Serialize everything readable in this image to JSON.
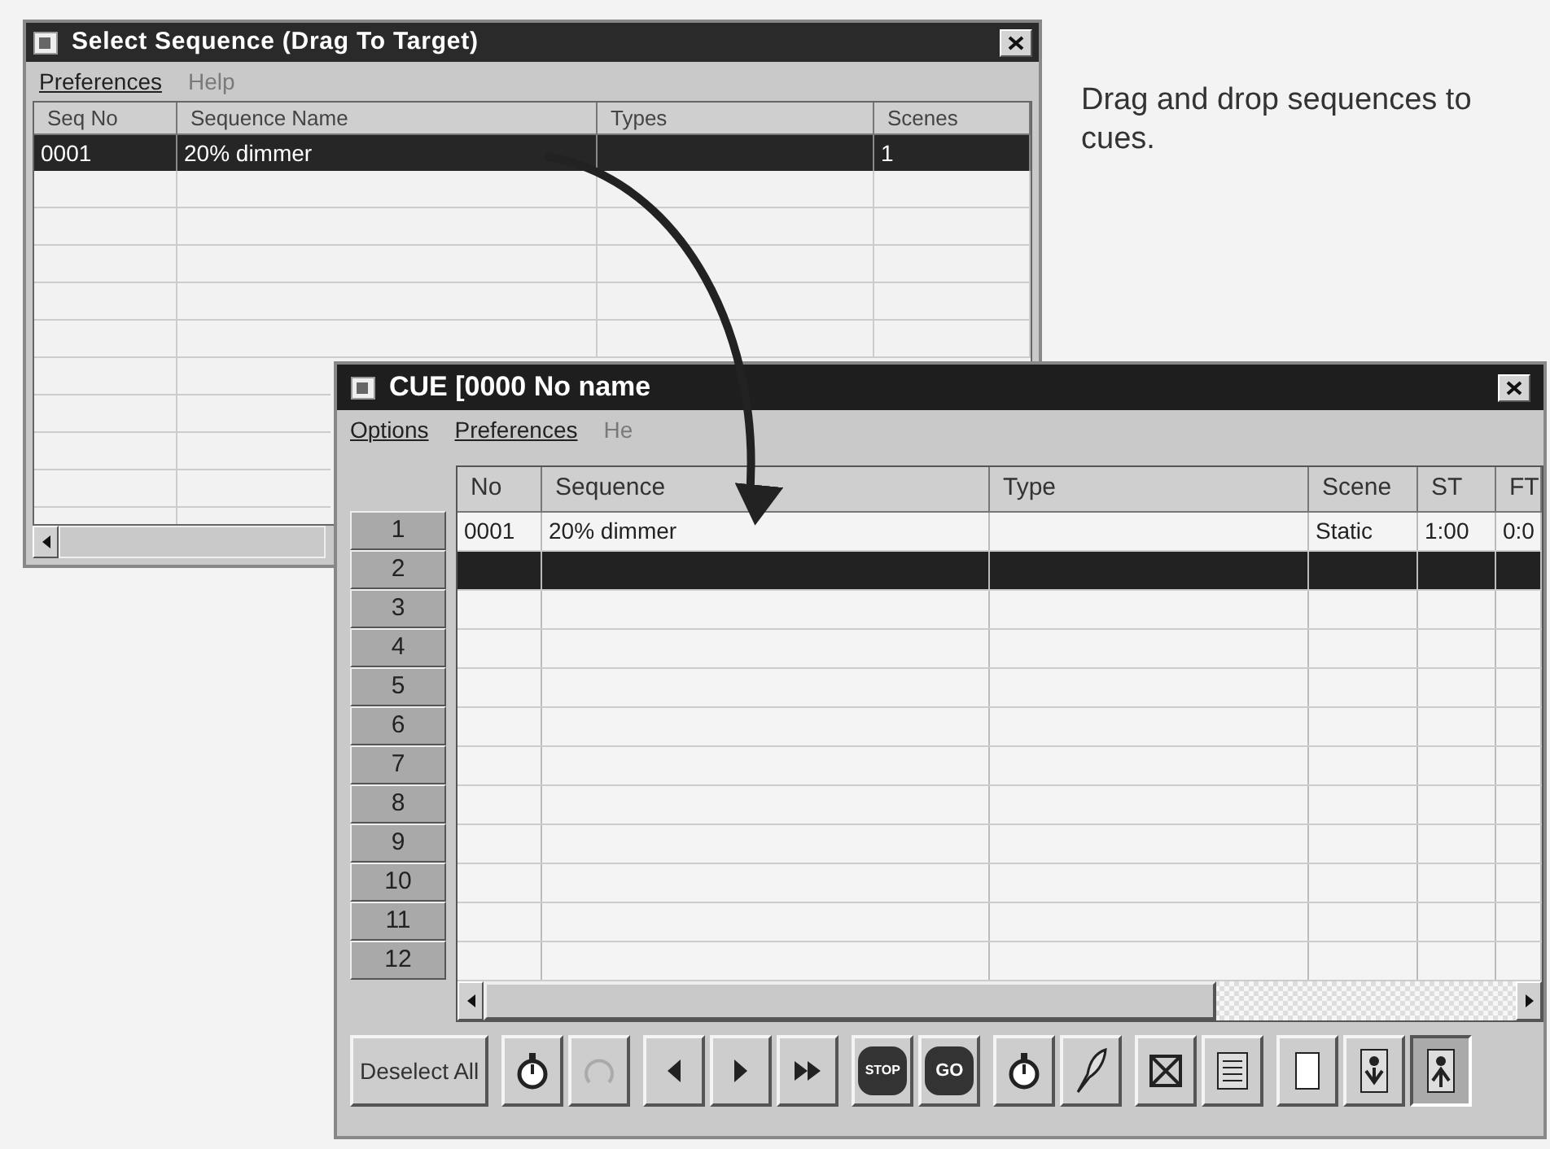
{
  "caption": "Drag and drop sequences to cues.",
  "sequence_window": {
    "title": "Select Sequence (Drag To Target)",
    "menu": [
      {
        "label": "Preferences",
        "disabled": false
      },
      {
        "label": "Help",
        "disabled": true
      }
    ],
    "columns": [
      "Seq No",
      "Sequence Name",
      "Types",
      "Scenes"
    ],
    "rows": [
      {
        "cells": [
          "0001",
          "20% dimmer",
          "",
          "1"
        ],
        "selected": true
      }
    ]
  },
  "cue_window": {
    "title": "CUE [0000 No name",
    "menu": [
      {
        "label": "Options",
        "disabled": false
      },
      {
        "label": "Preferences",
        "disabled": false
      },
      {
        "label": "He",
        "disabled": true
      }
    ],
    "row_numbers": [
      "1",
      "2",
      "3",
      "4",
      "5",
      "6",
      "7",
      "8",
      "9",
      "10",
      "11",
      "12"
    ],
    "columns": [
      "No",
      "Sequence",
      "Type",
      "Scene",
      "ST",
      "FT"
    ],
    "rows": [
      {
        "cells": [
          "0001",
          "20% dimmer",
          "",
          "Static",
          "1:00",
          "0:0"
        ],
        "selected": false
      },
      {
        "cells": [
          "",
          "",
          "",
          "",
          "",
          ""
        ],
        "selected": true
      }
    ],
    "toolbar": [
      {
        "kind": "text",
        "label": "Deselect All",
        "disabled": false,
        "pressed": false
      },
      {
        "kind": "stopwatch",
        "disabled": false,
        "pressed": false
      },
      {
        "kind": "loop",
        "disabled": true,
        "pressed": false
      },
      {
        "kind": "back",
        "disabled": false,
        "pressed": false
      },
      {
        "kind": "play",
        "disabled": false,
        "pressed": false
      },
      {
        "kind": "forward",
        "disabled": false,
        "pressed": false
      },
      {
        "kind": "sign",
        "label": "STOP",
        "disabled": false,
        "pressed": false
      },
      {
        "kind": "sign",
        "label": "GO",
        "disabled": false,
        "pressed": false
      },
      {
        "kind": "timer",
        "disabled": false,
        "pressed": false
      },
      {
        "kind": "pen",
        "disabled": false,
        "pressed": false
      },
      {
        "kind": "crossbox",
        "disabled": false,
        "pressed": false
      },
      {
        "kind": "list",
        "disabled": false,
        "pressed": false
      },
      {
        "kind": "page",
        "disabled": false,
        "pressed": false
      },
      {
        "kind": "person-down",
        "disabled": false,
        "pressed": false
      },
      {
        "kind": "person-up",
        "disabled": false,
        "pressed": true
      }
    ]
  }
}
